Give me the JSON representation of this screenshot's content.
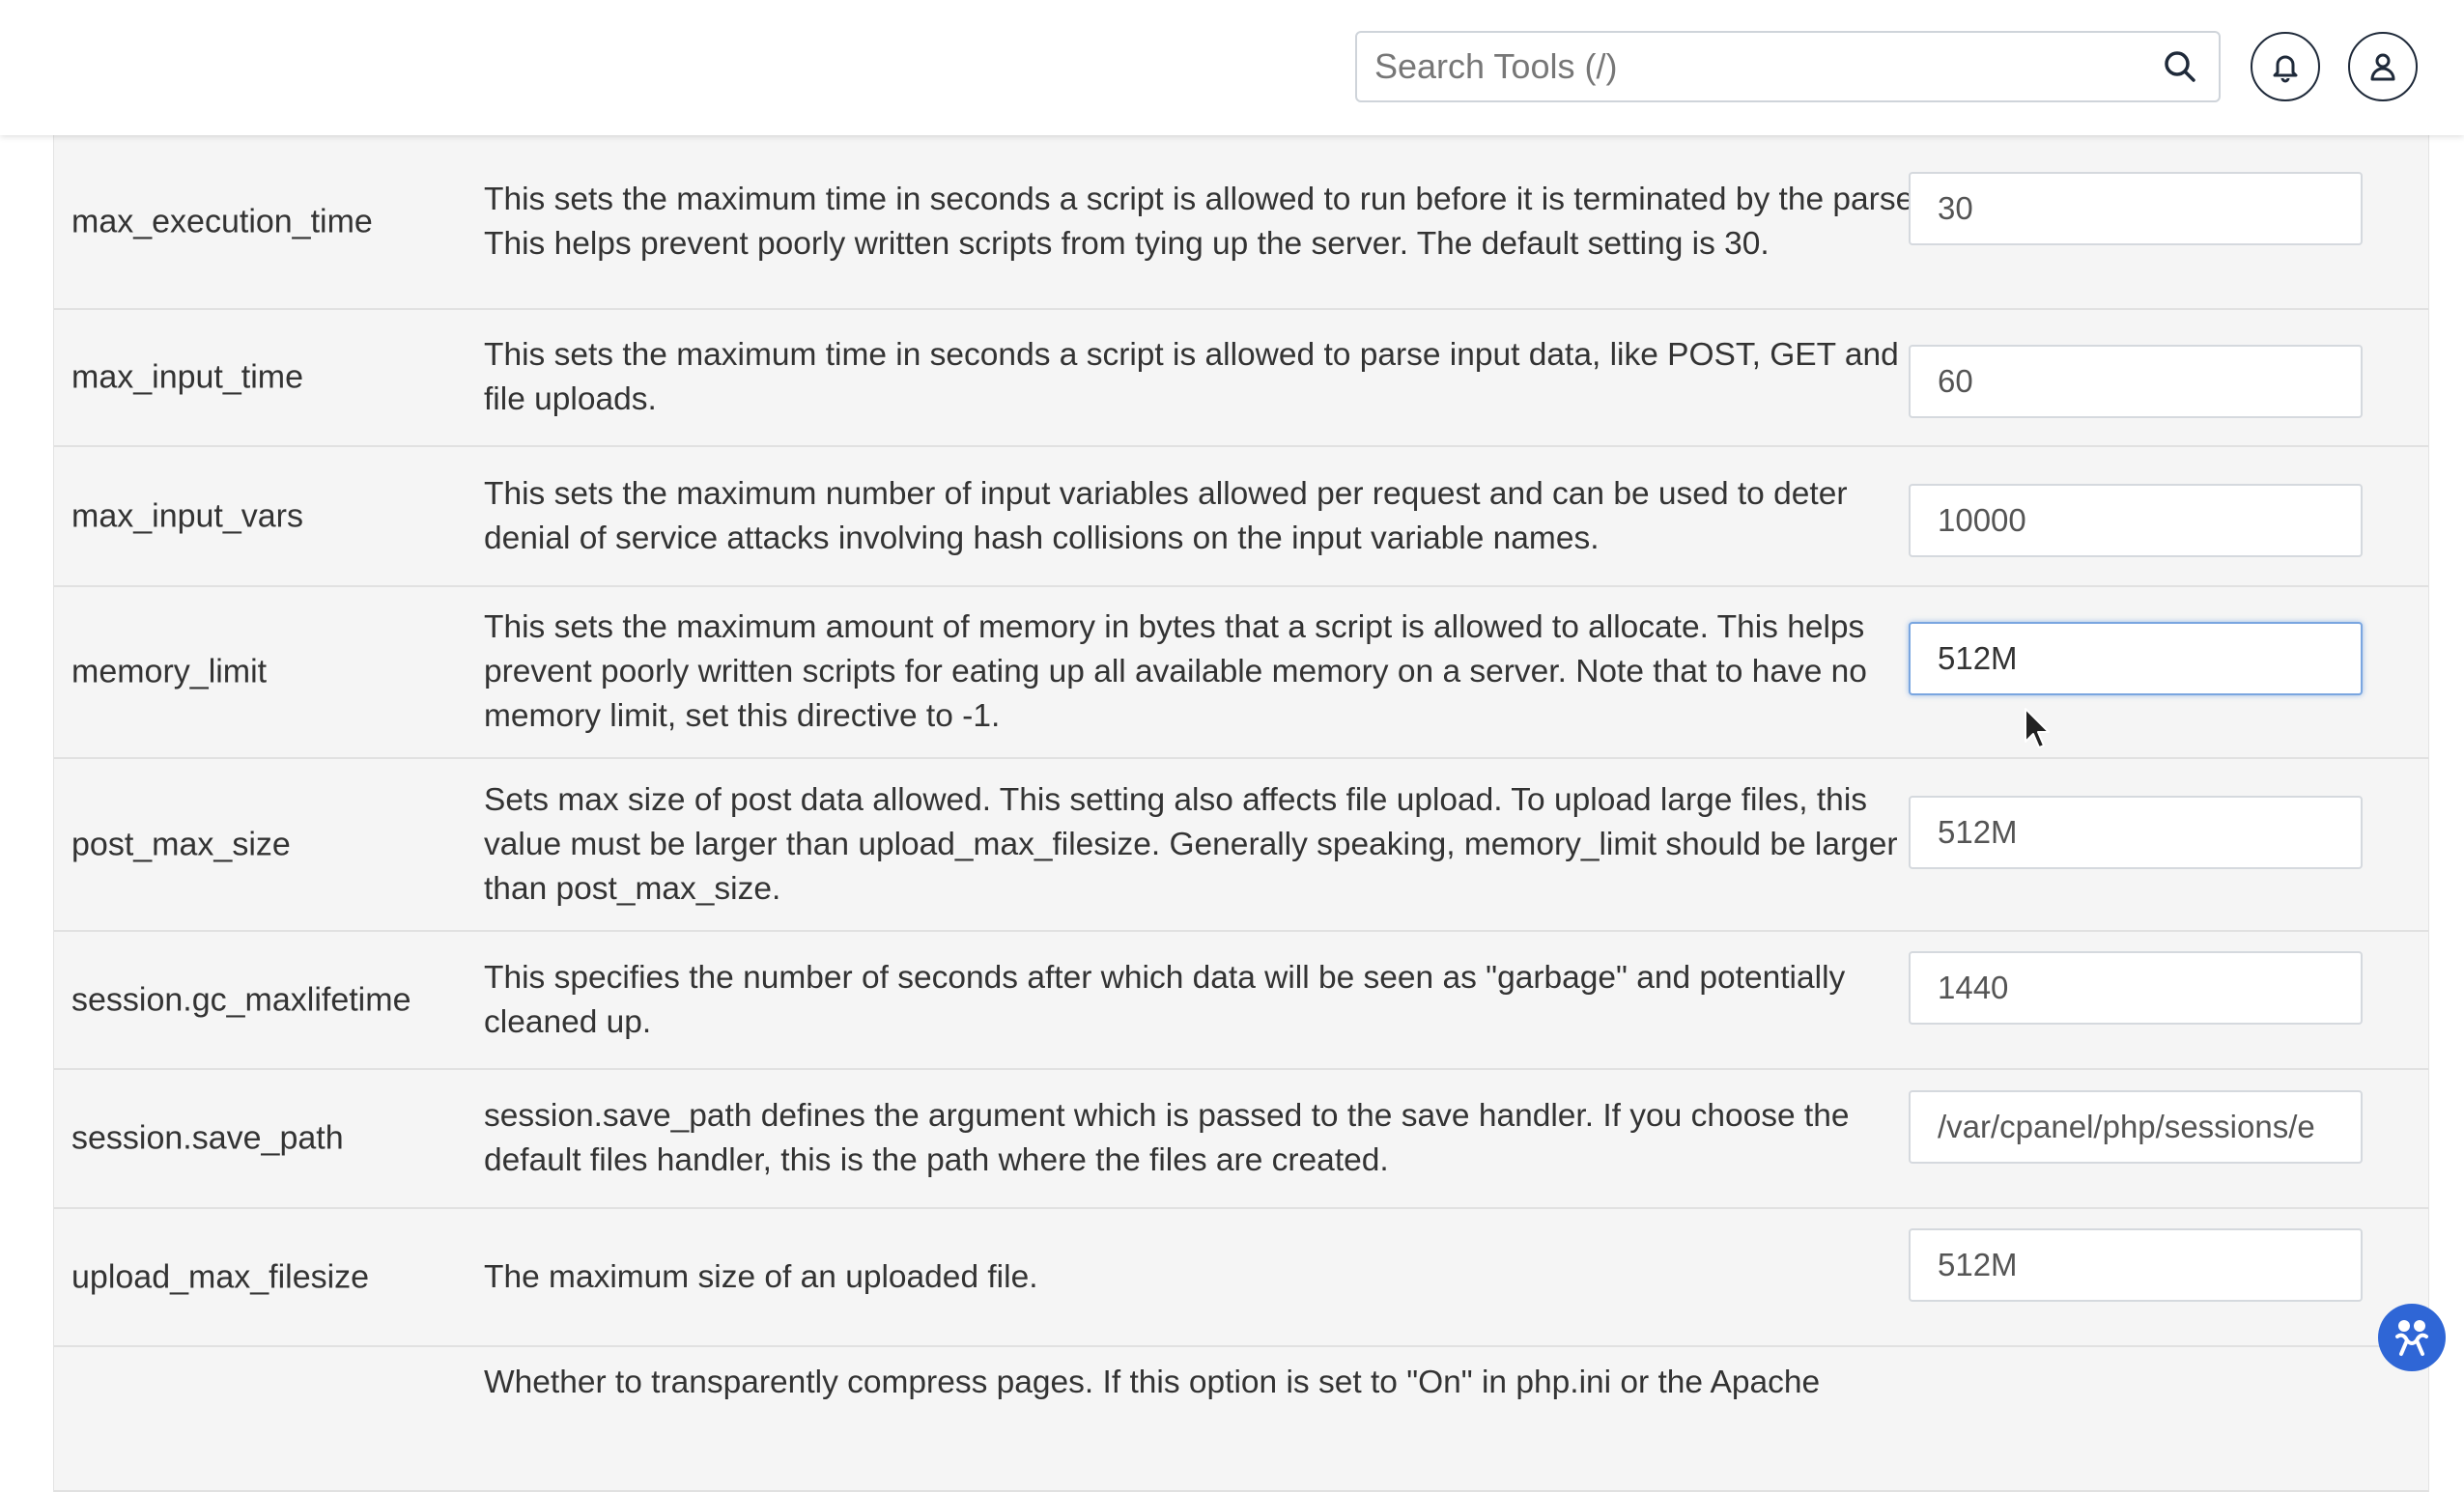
{
  "header": {
    "search": {
      "placeholder": "Search Tools (/)",
      "value": ""
    }
  },
  "directives": [
    {
      "name": "max_execution_time",
      "description": "This sets the maximum time in seconds a script is allowed to run before it is terminated by the parser. This helps prevent poorly written scripts from tying up the server. The default setting is 30.",
      "value": "30"
    },
    {
      "name": "max_input_time",
      "description": "This sets the maximum time in seconds a script is allowed to parse input data, like POST, GET and file uploads.",
      "value": "60"
    },
    {
      "name": "max_input_vars",
      "description": "This sets the maximum number of input variables allowed per request and can be used to deter denial of service attacks involving hash collisions on the input variable names.",
      "value": "10000"
    },
    {
      "name": "memory_limit",
      "description": "This sets the maximum amount of memory in bytes that a script is allowed to allocate. This helps prevent poorly written scripts for eating up all available memory on a server. Note that to have no memory limit, set this directive to -1.",
      "value": "512M"
    },
    {
      "name": "post_max_size",
      "description": "Sets max size of post data allowed. This setting also affects file upload. To upload large files, this value must be larger than upload_max_filesize. Generally speaking, memory_limit should be larger than post_max_size.",
      "value": "512M"
    },
    {
      "name": "session.gc_maxlifetime",
      "description": "This specifies the number of seconds after which data will be seen as \"garbage\" and potentially cleaned up.",
      "value": "1440"
    },
    {
      "name": "session.save_path",
      "description": "session.save_path defines the argument which is passed to the save handler. If you choose the default files handler, this is the path where the files are created.",
      "value": "/var/cpanel/php/sessions/e"
    },
    {
      "name": "upload_max_filesize",
      "description": "The maximum size of an uploaded file.",
      "value": "512M"
    },
    {
      "name": "",
      "description": "Whether to transparently compress pages. If this option is set to \"On\" in php.ini or the Apache",
      "value": ""
    }
  ],
  "colors": {
    "row_background": "#f5f5f5",
    "focus_border": "#7aa6e0",
    "fab": "#2f66d6",
    "icon_outline": "#1f2a3a"
  }
}
